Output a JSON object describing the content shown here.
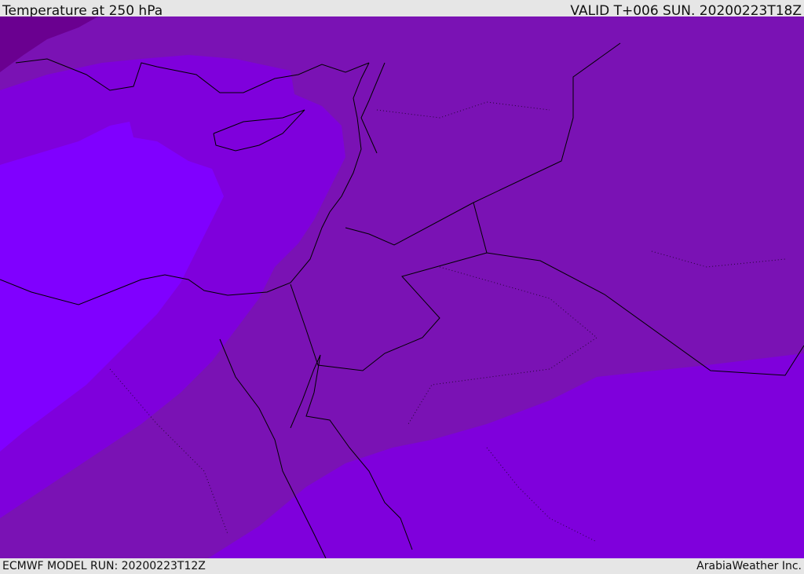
{
  "header": {
    "title": "Temperature at 250 hPa",
    "valid": "VALID T+006 SUN. 20200223T18Z"
  },
  "footer": {
    "model_run": "ECMWF MODEL RUN: 20200223T12Z",
    "credit": "ArabiaWeather Inc."
  },
  "colors": {
    "darkest": "#6a0090",
    "mid": "#7a12b4",
    "bright": "#7f00dc",
    "brightest": "#8000ff",
    "bar": "#e6e6e6"
  }
}
